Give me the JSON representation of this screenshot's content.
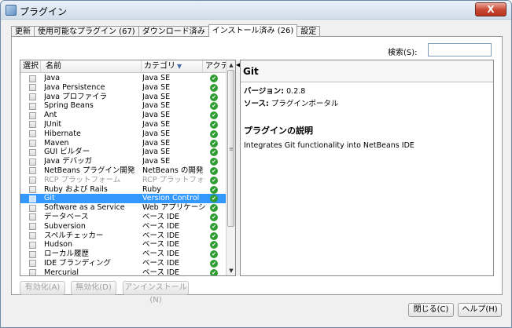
{
  "window": {
    "title": "プラグイン",
    "close_label": "X"
  },
  "tabs": [
    {
      "label": "更新"
    },
    {
      "label": "使用可能なプラグイン (67)"
    },
    {
      "label": "ダウンロード済み"
    },
    {
      "label": "インストール済み (26)",
      "active": true
    },
    {
      "label": "設定"
    }
  ],
  "search": {
    "label": "検索(S):",
    "value": ""
  },
  "table": {
    "headers": {
      "select": "選択",
      "name": "名前",
      "category": "カテゴリ",
      "active": "アクテ..."
    },
    "rows": [
      {
        "name": "Java",
        "category": "Java SE"
      },
      {
        "name": "Java Persistence",
        "category": "Java SE"
      },
      {
        "name": "Java プロファイラ",
        "category": "Java SE"
      },
      {
        "name": "Spring Beans",
        "category": "Java SE"
      },
      {
        "name": "Ant",
        "category": "Java SE"
      },
      {
        "name": "JUnit",
        "category": "Java SE"
      },
      {
        "name": "Hibernate",
        "category": "Java SE"
      },
      {
        "name": "Maven",
        "category": "Java SE"
      },
      {
        "name": "GUI ビルダー",
        "category": "Java SE"
      },
      {
        "name": "Java デバッガ",
        "category": "Java SE"
      },
      {
        "name": "NetBeans プラグイン開発",
        "category": "NetBeans の開発"
      },
      {
        "name": "RCP プラットフォーム",
        "category": "RCP プラットフォーム",
        "dim": true
      },
      {
        "name": "Ruby および Rails",
        "category": "Ruby"
      },
      {
        "name": "Git",
        "category": "Version Control",
        "selected": true
      },
      {
        "name": "Software as a Service",
        "category": "Web アプリケーション"
      },
      {
        "name": "データベース",
        "category": "ベース IDE"
      },
      {
        "name": "Subversion",
        "category": "ベース IDE"
      },
      {
        "name": "スペルチェッカー",
        "category": "ベース IDE"
      },
      {
        "name": "Hudson",
        "category": "ベース IDE"
      },
      {
        "name": "ローカル履歴",
        "category": "ベース IDE"
      },
      {
        "name": "IDE ブランディング",
        "category": "ベース IDE"
      },
      {
        "name": "Mercurial",
        "category": "ベース IDE"
      }
    ]
  },
  "detail": {
    "title": "Git",
    "version_label": "バージョン:",
    "version_value": "0.2.8",
    "source_label": "ソース:",
    "source_value": "プラグインポータル",
    "section_title": "プラグインの説明",
    "description": "Integrates Git functionality into NetBeans IDE"
  },
  "actions": {
    "enable": "有効化(A)",
    "disable": "無効化(D)",
    "uninstall": "アンインストール(N)"
  },
  "footer": {
    "close": "閉じる(C)",
    "help": "ヘルプ(H)"
  },
  "colors": {
    "selection": "#3399ff",
    "active_check": "#2e9d32",
    "titlebar": "#d3deeb"
  },
  "icons": {
    "active": "check-circle-icon",
    "sort": "sort-descending-icon",
    "split": "chevron-left-icon"
  }
}
